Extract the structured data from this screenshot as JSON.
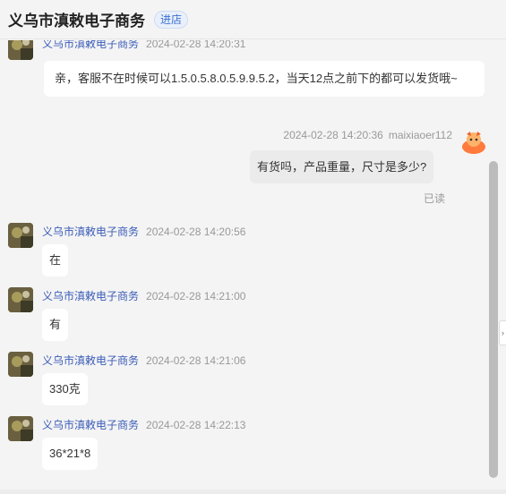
{
  "header": {
    "shop_name": "义乌市滇敕电子商务",
    "enter_shop": "进店"
  },
  "messages": [
    {
      "sender": "义乌市滇敕电子商务",
      "time": "2024-02-28 14:20:31",
      "text": "亲，客服不在时候可以1.5.0.5.8.0.5.9.9.5.2，当天12点之前下的都可以发货哦~"
    },
    {
      "sender": "maixiaoer112",
      "time": "2024-02-28 14:20:36",
      "text": "有货吗，产品重量，尺寸是多少?",
      "status": "已读"
    },
    {
      "sender": "义乌市滇敕电子商务",
      "time": "2024-02-28 14:20:56",
      "text": "在"
    },
    {
      "sender": "义乌市滇敕电子商务",
      "time": "2024-02-28 14:21:00",
      "text": "有"
    },
    {
      "sender": "义乌市滇敕电子商务",
      "time": "2024-02-28 14:21:06",
      "text": "330克"
    },
    {
      "sender": "义乌市滇敕电子商务",
      "time": "2024-02-28 14:22:13",
      "text": "36*21*8"
    }
  ],
  "side_tab": {
    "icon": "chevron-right-icon",
    "glyph": "›"
  },
  "colors": {
    "sender_link": "#3a5cb8",
    "enter_shop": "#3b6fd4",
    "user_avatar": "#ff7a3c"
  }
}
